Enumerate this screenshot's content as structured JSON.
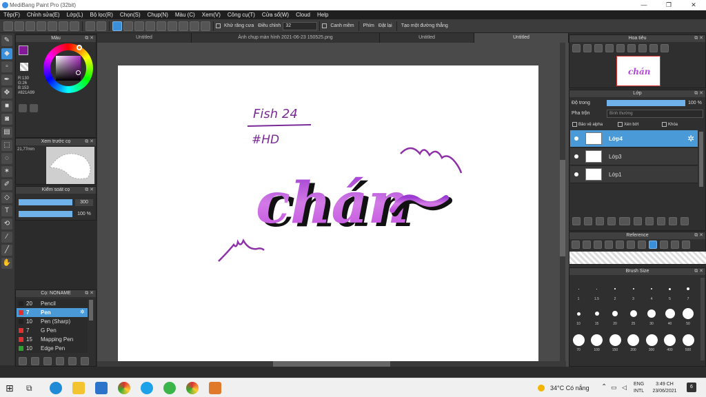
{
  "window": {
    "title": "MediBang Paint Pro (32bit)",
    "controls": [
      "—",
      "❐",
      "✕"
    ]
  },
  "menu": [
    "Tệp(F)",
    "Chỉnh sửa(E)",
    "Lớp(L)",
    "Bộ lọc(R)",
    "Chọn(S)",
    "Chụp(N)",
    "Màu (C)",
    "Xem(V)",
    "Công cụ(T)",
    "Cửa sổ(W)",
    "Cloud",
    "Help"
  ],
  "toolbar": {
    "antialias_label": "Khử răng cưa",
    "adjust_label": "Điều chỉnh",
    "adjust_value": "32",
    "snap_label": "Canh mềm",
    "phim_label": "Phím",
    "cancel_label": "Đặt lại",
    "guide_label": "Tạo một đường thẳng"
  },
  "tabs": [
    "Untitled",
    "Ảnh chụp màn hình 2021-06-23 150525.png",
    "Untitled",
    "Untitled"
  ],
  "color_panel": {
    "title": "Màu",
    "r": "R:130",
    "g": "G:26",
    "b": "B:153",
    "hex": "#821A99",
    "primary": "#821a99",
    "secondary": "#ffffff"
  },
  "preview_panel": {
    "title": "Xem trước cọ",
    "size": "21,77mm"
  },
  "brush_control": {
    "title": "Kiểm soát cọ",
    "size_value": "300",
    "opacity_value": "100 %",
    "size_level": 1,
    "opacity_level": 1
  },
  "brush_list": {
    "title": "Cọ: NONAME",
    "items": [
      {
        "num": "20",
        "name": "Pencil",
        "color": "#222222"
      },
      {
        "num": "7",
        "name": "Pen",
        "color": "#e03030"
      },
      {
        "num": "10",
        "name": "Pen (Sharp)",
        "color": "#222222"
      },
      {
        "num": "7",
        "name": "G Pen",
        "color": "#e03030"
      },
      {
        "num": "15",
        "name": "Mapping Pen",
        "color": "#e03030"
      },
      {
        "num": "10",
        "name": "Edge Pen",
        "color": "#30a030"
      }
    ]
  },
  "navigator": {
    "title": "Hoa tiêu"
  },
  "layer_panel": {
    "title": "Lớp",
    "opacity_label": "Độ trong",
    "opacity_value": "100 %",
    "opacity_level": 1,
    "blend_label": "Pha trộn",
    "blend_value": "Bình thường",
    "protect_alpha": "Bảo vệ alpha",
    "clip": "Xén bớt",
    "lock": "Khóa",
    "layers": [
      "Lớp4",
      "Lớp3",
      "Lớp1"
    ]
  },
  "reference_panel": {
    "title": "Reference"
  },
  "brush_size_panel": {
    "title": "Brush Size",
    "rows": [
      [
        "1",
        "1.5",
        "2",
        "3",
        "4",
        "5",
        "7"
      ],
      [
        "10",
        "15",
        "20",
        "25",
        "30",
        "40",
        "50"
      ],
      [
        "70",
        "100",
        "150",
        "200",
        "300",
        "400",
        "500"
      ]
    ]
  },
  "canvas": {
    "text_fish": "Fish 24",
    "text_hd": "#HD",
    "text_main": "chán",
    "tilde": "~"
  },
  "taskbar": {
    "weather": "34°C Có nắng",
    "lang1": "ENG",
    "lang2": "INTL",
    "time": "3:49 CH",
    "date": "23/06/2021",
    "notif": "6"
  }
}
